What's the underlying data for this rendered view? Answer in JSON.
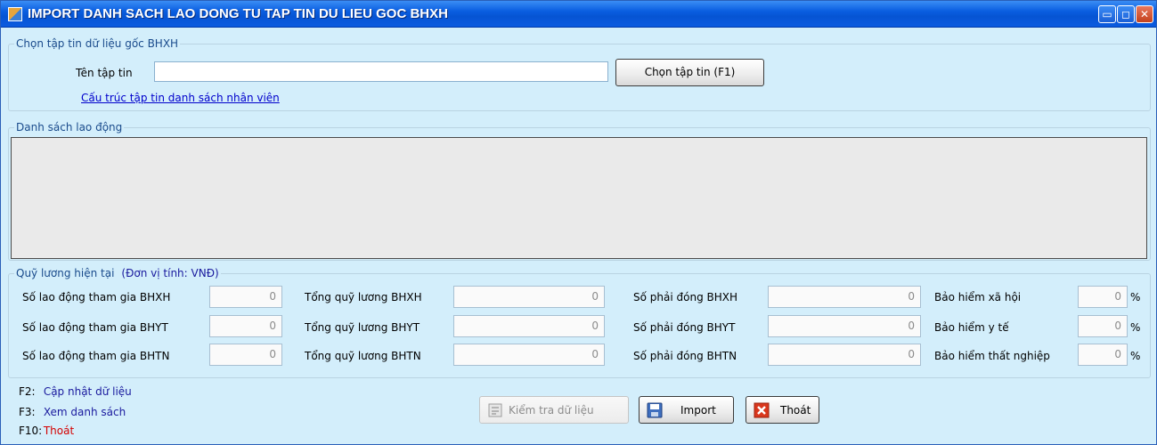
{
  "window": {
    "title": "IMPORT DANH SACH LAO DONG TU TAP TIN DU LIEU GOC BHXH",
    "controls": {
      "minimize": "▭",
      "maximize": "◻",
      "close": "✕"
    }
  },
  "file_group": {
    "legend": "Chọn tập tin dữ liệu gốc BHXH",
    "filename_label": "Tên tập tin",
    "filename_value": "",
    "choose_button": "Chọn tập tin (F1)",
    "structure_link": "Cấu trúc tập tin danh sách nhân viên"
  },
  "list_group": {
    "legend": "Danh sách lao động"
  },
  "fund_group": {
    "legend": "Quỹ lương hiện tại",
    "unit": "(Đơn vị tính: VNĐ)",
    "col1": [
      {
        "label": "Số lao động tham gia BHXH",
        "value": "0"
      },
      {
        "label": "Số lao động tham gia BHYT",
        "value": "0"
      },
      {
        "label": "Số lao động tham gia BHTN",
        "value": "0"
      }
    ],
    "col2": [
      {
        "label": "Tổng quỹ lương BHXH",
        "value": "0"
      },
      {
        "label": "Tổng quỹ lương BHYT",
        "value": "0"
      },
      {
        "label": "Tổng quỹ lương BHTN",
        "value": "0"
      }
    ],
    "col3": [
      {
        "label": "Số phải đóng BHXH",
        "value": "0"
      },
      {
        "label": "Số phải đóng BHYT",
        "value": "0"
      },
      {
        "label": "Số phải đóng BHTN",
        "value": "0"
      }
    ],
    "col4": [
      {
        "label": "Bảo hiểm xã hội",
        "value": "0",
        "unit": "%"
      },
      {
        "label": "Bảo hiểm y tế",
        "value": "0",
        "unit": "%"
      },
      {
        "label": "Bảo hiểm thất nghiệp",
        "value": "0",
        "unit": "%"
      }
    ]
  },
  "hotkeys": [
    {
      "key": "F2:",
      "action": "Cập nhật dữ liệu"
    },
    {
      "key": "F3:",
      "action": "Xem danh sách"
    },
    {
      "key": "F10:",
      "action": "Thoát"
    }
  ],
  "buttons": {
    "check": "Kiểm tra dữ liệu",
    "import": "Import",
    "exit": "Thoát"
  },
  "colors": {
    "background": "#d3eefb",
    "titlebar": "#0654d3",
    "link": "#0000cc",
    "hotkey_action": "#1a1a9e",
    "exit_hotkey": "#d40000"
  }
}
